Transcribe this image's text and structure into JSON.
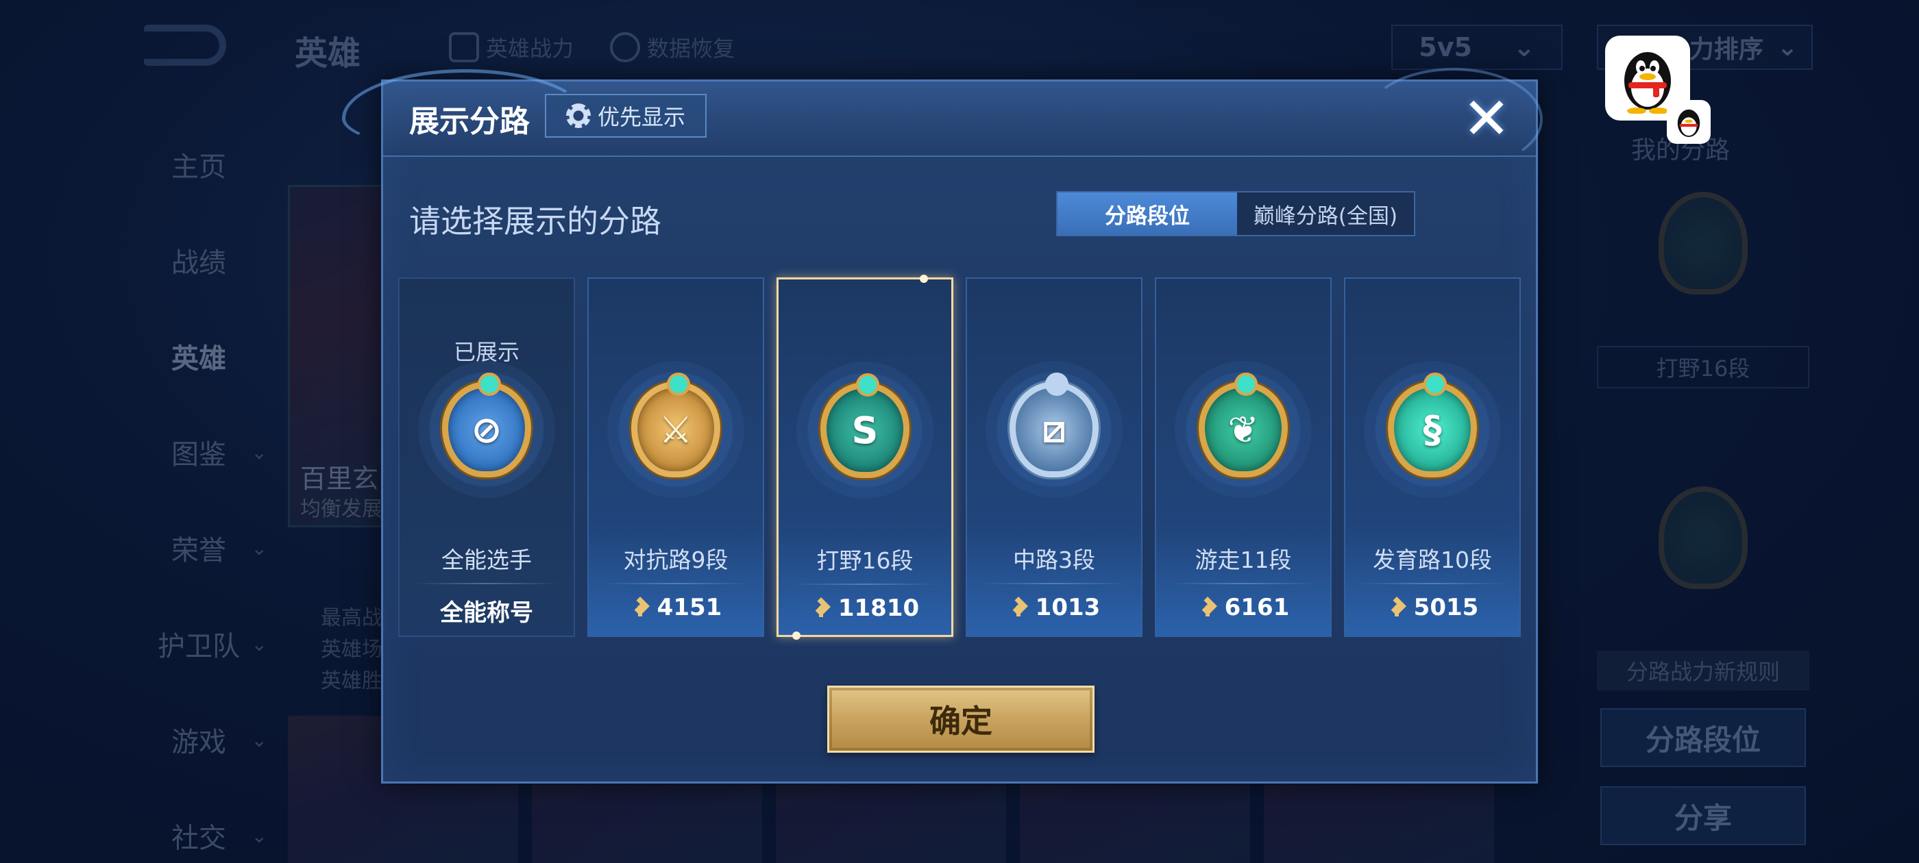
{
  "background": {
    "title": "英雄",
    "links": [
      "英雄战力",
      "数据恢复"
    ],
    "mode": "5v5",
    "sort": "力排序",
    "nav": [
      {
        "label": "主页",
        "chevron": false
      },
      {
        "label": "战绩",
        "chevron": false
      },
      {
        "label": "英雄",
        "chevron": false,
        "active": true
      },
      {
        "label": "图鉴",
        "chevron": true
      },
      {
        "label": "荣誉",
        "chevron": true
      },
      {
        "label": "护卫队",
        "chevron": true
      },
      {
        "label": "游戏",
        "chevron": true
      },
      {
        "label": "社交",
        "chevron": true
      }
    ],
    "hero": {
      "name": "百里玄",
      "sub": "均衡发展",
      "stats": [
        "最高战",
        "英雄场",
        "英雄胜"
      ]
    },
    "right_panel": {
      "title": "我的分路",
      "label": "打野16段",
      "rule": "分路战力新规则",
      "btn_lane": "分路段位",
      "btn_share": "分享"
    }
  },
  "modal": {
    "title": "展示分路",
    "priority_btn": "优先显示",
    "subtitle": "请选择展示的分路",
    "tabs": [
      {
        "label": "分路段位",
        "active": true
      },
      {
        "label": "巅峰分路(全国)",
        "active": false
      }
    ],
    "cards": [
      {
        "status": "已展示",
        "glyph": "⊘",
        "style": "blue",
        "name": "全能选手",
        "value": "全能称号",
        "points": false
      },
      {
        "status": "",
        "glyph": "⚔",
        "style": "bronze",
        "name": "对抗路9段",
        "value": "4151",
        "points": true
      },
      {
        "status": "",
        "glyph": "S",
        "style": "teal",
        "name": "打野16段",
        "value": "11810",
        "points": true,
        "selected": true
      },
      {
        "status": "",
        "glyph": "⧄",
        "style": "silver",
        "name": "中路3段",
        "value": "1013",
        "points": true
      },
      {
        "status": "",
        "glyph": "❦",
        "style": "green",
        "name": "游走11段",
        "value": "6161",
        "points": true
      },
      {
        "status": "",
        "glyph": "§",
        "style": "mint",
        "name": "发育路10段",
        "value": "5015",
        "points": true
      }
    ],
    "confirm": "确定"
  },
  "colors": {
    "accent": "#4c8ad8",
    "gold": "#d9a64a",
    "selected_border": "#f2d9a2"
  }
}
